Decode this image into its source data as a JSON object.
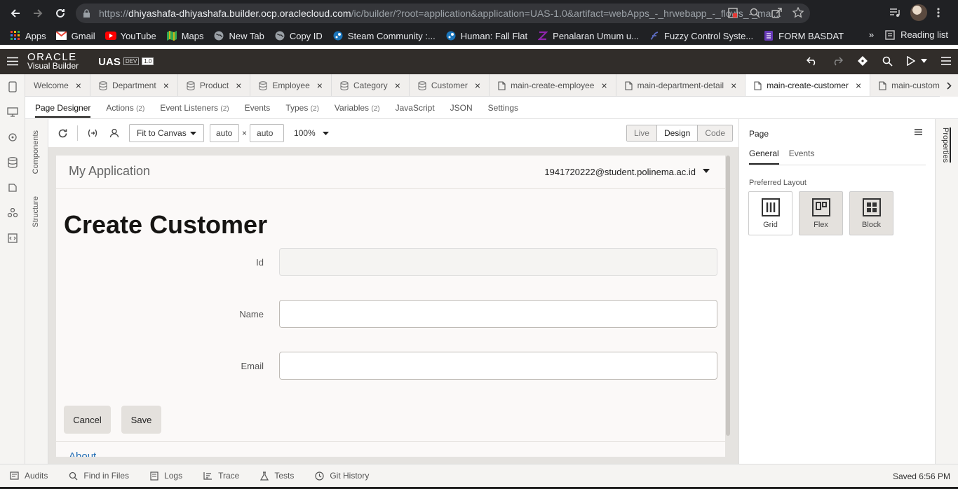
{
  "browser": {
    "url_prefix": "https://",
    "url_host": "dhiyashafa-dhiyashafa.builder.ocp.oraclecloud.com",
    "url_path": "/ic/builder/?root=application&application=UAS-1.0&artifact=webApps_-_hrwebapp_-_flows_-_mai..."
  },
  "bookmarks": [
    {
      "label": "Apps",
      "icon": "apps-grid-icon",
      "color": "#ea4335"
    },
    {
      "label": "Gmail",
      "icon": "gmail-icon",
      "color": "#ea4335"
    },
    {
      "label": "YouTube",
      "icon": "youtube-icon",
      "color": "#ff0000"
    },
    {
      "label": "Maps",
      "icon": "maps-icon",
      "color": "#34a853"
    },
    {
      "label": "New Tab",
      "icon": "globe-icon",
      "color": "#9aa0a6"
    },
    {
      "label": "Copy ID",
      "icon": "globe-icon",
      "color": "#9aa0a6"
    },
    {
      "label": "Steam Community :...",
      "icon": "steam-icon",
      "color": "#1b75bb"
    },
    {
      "label": "Human: Fall Flat",
      "icon": "steam-icon",
      "color": "#1b75bb"
    },
    {
      "label": "Penalaran Umum u...",
      "icon": "z-icon",
      "color": "#8e24aa"
    },
    {
      "label": "Fuzzy Control Syste...",
      "icon": "fuzzy-icon",
      "color": "#3f51b5"
    },
    {
      "label": "FORM BASDAT",
      "icon": "forms-icon",
      "color": "#673ab7"
    }
  ],
  "bookmarks_more": "»",
  "reading_list": "Reading list",
  "vb": {
    "brand_line1": "ORACLE",
    "brand_line2": "Visual Builder",
    "app_name": "UAS",
    "tag_env": "DEV",
    "tag_version": "1.0"
  },
  "file_tabs": [
    {
      "label": "Welcome",
      "icon": "none",
      "active": false
    },
    {
      "label": "Department",
      "icon": "database-icon",
      "active": false
    },
    {
      "label": "Product",
      "icon": "database-icon",
      "active": false
    },
    {
      "label": "Employee",
      "icon": "database-icon",
      "active": false
    },
    {
      "label": "Category",
      "icon": "database-icon",
      "active": false
    },
    {
      "label": "Customer",
      "icon": "database-icon",
      "active": false
    },
    {
      "label": "main-create-employee",
      "icon": "page-icon",
      "active": false
    },
    {
      "label": "main-department-detail",
      "icon": "page-icon",
      "active": false
    },
    {
      "label": "main-create-customer",
      "icon": "page-icon",
      "active": true
    },
    {
      "label": "main-custome",
      "icon": "page-icon",
      "active": false
    }
  ],
  "sub_tabs": [
    {
      "label": "Page Designer",
      "count": "",
      "active": true
    },
    {
      "label": "Actions",
      "count": "(2)",
      "active": false
    },
    {
      "label": "Event Listeners",
      "count": "(2)",
      "active": false
    },
    {
      "label": "Events",
      "count": "",
      "active": false
    },
    {
      "label": "Types",
      "count": "(2)",
      "active": false
    },
    {
      "label": "Variables",
      "count": "(2)",
      "active": false
    },
    {
      "label": "JavaScript",
      "count": "",
      "active": false
    },
    {
      "label": "JSON",
      "count": "",
      "active": false
    },
    {
      "label": "Settings",
      "count": "",
      "active": false
    }
  ],
  "side_labels": {
    "components": "Components",
    "structure": "Structure"
  },
  "toolbar": {
    "fit_mode": "Fit to Canvas",
    "width": "auto",
    "times": "×",
    "height": "auto",
    "zoom": "100%",
    "modes": [
      "Live",
      "Design",
      "Code"
    ],
    "active_mode": "Design"
  },
  "canvas": {
    "app_title": "My Application",
    "user_email": "1941720222@student.polinema.ac.id",
    "page_heading": "Create Customer",
    "fields": [
      {
        "label": "Id",
        "value": "",
        "readonly": true
      },
      {
        "label": "Name",
        "value": "",
        "readonly": false
      },
      {
        "label": "Email",
        "value": "",
        "readonly": false
      }
    ],
    "cancel_label": "Cancel",
    "save_label": "Save",
    "footer_link": "About"
  },
  "properties": {
    "title": "Page",
    "tabs": [
      "General",
      "Events"
    ],
    "section_label": "Preferred Layout",
    "layouts": [
      {
        "label": "Grid",
        "selected": false
      },
      {
        "label": "Flex",
        "selected": true
      },
      {
        "label": "Block",
        "selected": true
      }
    ],
    "side_tab": "Properties"
  },
  "bottom_bar": {
    "items": [
      "Audits",
      "Find in Files",
      "Logs",
      "Trace",
      "Tests",
      "Git History"
    ],
    "status": "Saved 6:56 PM"
  }
}
